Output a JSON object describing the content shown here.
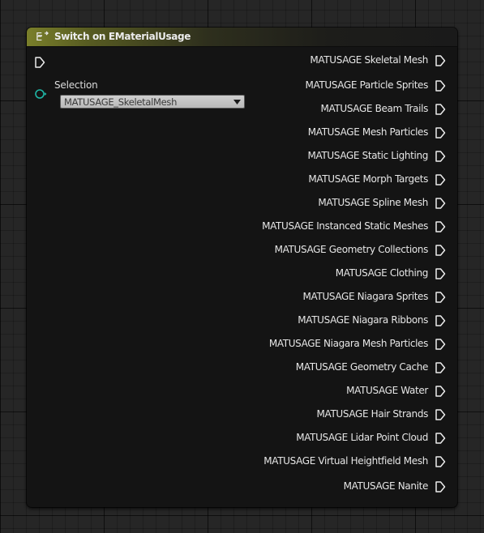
{
  "node": {
    "title": "Switch on EMaterialUsage",
    "header_color": "#7a7f2a",
    "header_icon": "switch-enum-icon",
    "selection": {
      "label": "Selection",
      "value": "MATUSAGE_SkeletalMesh",
      "pin_color": "#1fb6a6"
    },
    "outputs": [
      {
        "label": "MATUSAGE Skeletal Mesh"
      },
      {
        "label": "MATUSAGE Particle Sprites"
      },
      {
        "label": "MATUSAGE Beam Trails"
      },
      {
        "label": "MATUSAGE Mesh Particles"
      },
      {
        "label": "MATUSAGE Static Lighting"
      },
      {
        "label": "MATUSAGE Morph Targets"
      },
      {
        "label": "MATUSAGE Spline Mesh"
      },
      {
        "label": "MATUSAGE Instanced Static Meshes"
      },
      {
        "label": "MATUSAGE Geometry Collections"
      },
      {
        "label": "MATUSAGE Clothing"
      },
      {
        "label": "MATUSAGE Niagara Sprites"
      },
      {
        "label": "MATUSAGE Niagara Ribbons"
      },
      {
        "label": "MATUSAGE Niagara Mesh Particles"
      },
      {
        "label": "MATUSAGE Geometry Cache"
      },
      {
        "label": "MATUSAGE Water"
      },
      {
        "label": "MATUSAGE Hair Strands"
      },
      {
        "label": "MATUSAGE Lidar Point Cloud"
      },
      {
        "label": "MATUSAGE Virtual Heightfield Mesh"
      },
      {
        "label": "MATUSAGE Nanite"
      }
    ]
  }
}
